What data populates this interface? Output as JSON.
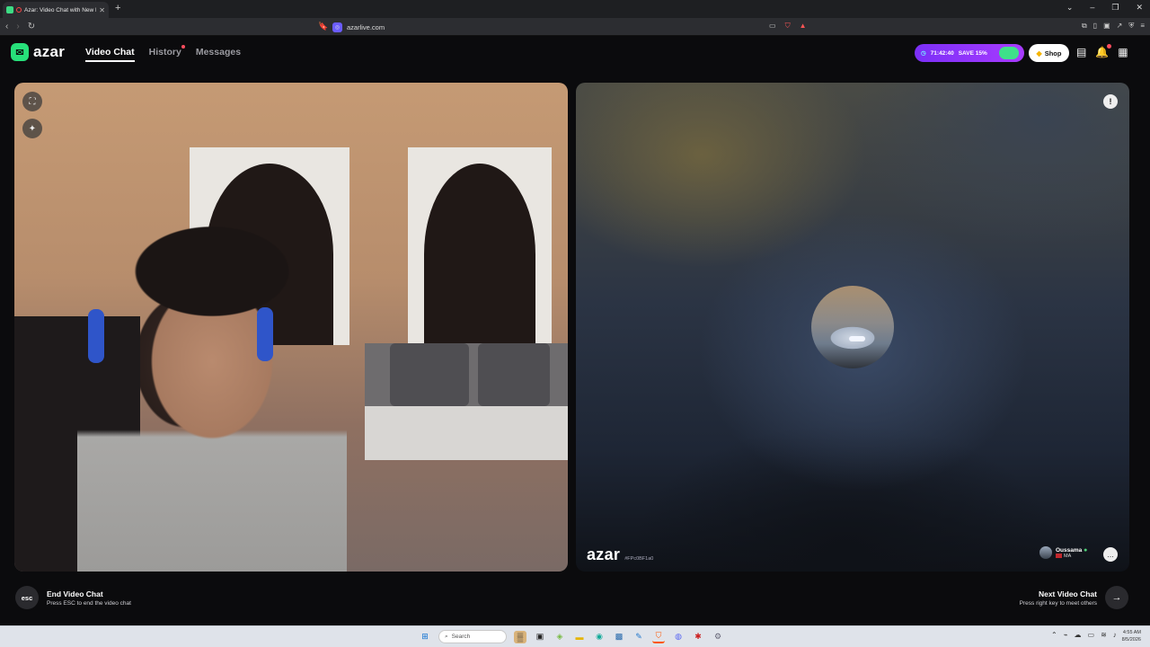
{
  "browser": {
    "tab_title": "Azar: Video Chat with New P...",
    "new_tab": "+",
    "url": "azarlive.com",
    "window_controls": [
      "chevron-down-icon",
      "minimize-icon",
      "restore-icon",
      "close-icon"
    ]
  },
  "header": {
    "logo_text": "azar",
    "nav": [
      {
        "label": "Video Chat",
        "active": true
      },
      {
        "label": "History",
        "active": false,
        "has_notification": true
      },
      {
        "label": "Messages",
        "active": false
      }
    ],
    "promo": {
      "timer": "71:42:40",
      "label": "SAVE 15%"
    },
    "shop_label": "Shop",
    "colors": {
      "accent": "#27e07a",
      "promo": "#8a35fb",
      "badge": "#ff4d5e"
    }
  },
  "remote": {
    "watermark": "azar",
    "user_id": "#FPc0BF1a0",
    "peer_name": "Oussama",
    "peer_country": "MA"
  },
  "bottom": {
    "esc_key": "esc",
    "end_title": "End Video Chat",
    "end_sub": "Press ESC to end the video chat",
    "next_title": "Next Video Chat",
    "next_sub": "Press right key to meet others"
  },
  "taskbar": {
    "search_placeholder": "Search",
    "time": "4:55 AM",
    "date": "8/5/2026"
  }
}
